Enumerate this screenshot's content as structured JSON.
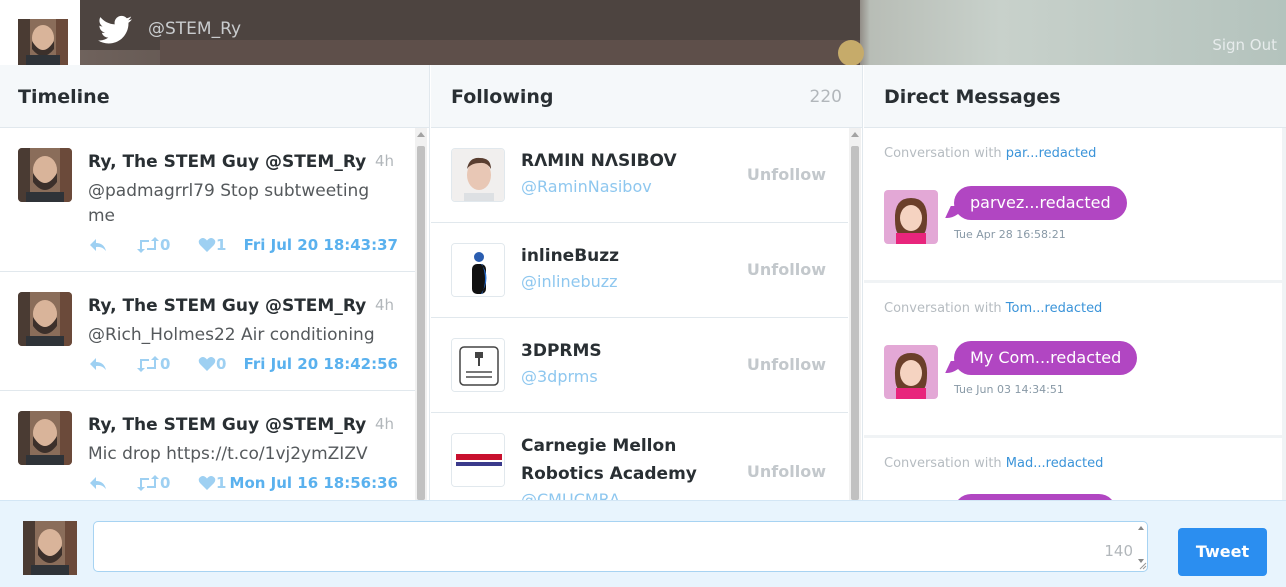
{
  "header": {
    "handle": "@STEM_Ry",
    "sign_out": "Sign Out",
    "bird_icon": "twitter-bird-icon"
  },
  "timeline": {
    "title": "Timeline",
    "tweets": [
      {
        "name": "Ry, The STEM Guy @STEM_Ry",
        "time": "4h",
        "text": "@padmagrrl79 Stop subtweeting me",
        "retweets": "0",
        "likes": "1",
        "date": "Fri Jul 20 18:43:37"
      },
      {
        "name": "Ry, The STEM Guy @STEM_Ry",
        "time": "4h",
        "text": "@Rich_Holmes22 Air conditioning",
        "retweets": "0",
        "likes": "0",
        "date": "Fri Jul 20 18:42:56"
      },
      {
        "name": "Ry, The STEM Guy @STEM_Ry",
        "time": "4h",
        "text": "Mic drop https://t.co/1vj2ymZIZV",
        "retweets": "0",
        "likes": "1",
        "date": "Mon Jul 16 18:56:36"
      }
    ]
  },
  "following": {
    "title": "Following",
    "count": "220",
    "users": [
      {
        "name": "RΛMIN NΛSIBOV",
        "handle": "@RaminNasibov",
        "action": "Unfollow"
      },
      {
        "name": "inlineBuzz",
        "handle": "@inlinebuzz",
        "action": "Unfollow"
      },
      {
        "name": "3DPRMS",
        "handle": "@3dprms",
        "action": "Unfollow"
      },
      {
        "name": "Carnegie Mellon Robotics Academy",
        "handle": "@CMUCMRA",
        "action": "Unfollow"
      }
    ]
  },
  "dm": {
    "title": "Direct Messages",
    "conversations": [
      {
        "label": "Conversation with ",
        "with": "par...redacted",
        "message": "parvez...redacted",
        "time": "Tue Apr 28 16:58:21"
      },
      {
        "label": "Conversation with ",
        "with": "Tom...redacted",
        "message": "My Com...redacted",
        "time": "Tue Jun 03 14:34:51"
      },
      {
        "label": "Conversation with ",
        "with": "Mad...redacted",
        "message": "",
        "time": ""
      }
    ]
  },
  "composer": {
    "value": "",
    "remaining": "140",
    "button": "Tweet"
  },
  "colors": {
    "accent": "#2b8ef0",
    "bubble": "#b146c2",
    "link": "#5ab1ee"
  }
}
